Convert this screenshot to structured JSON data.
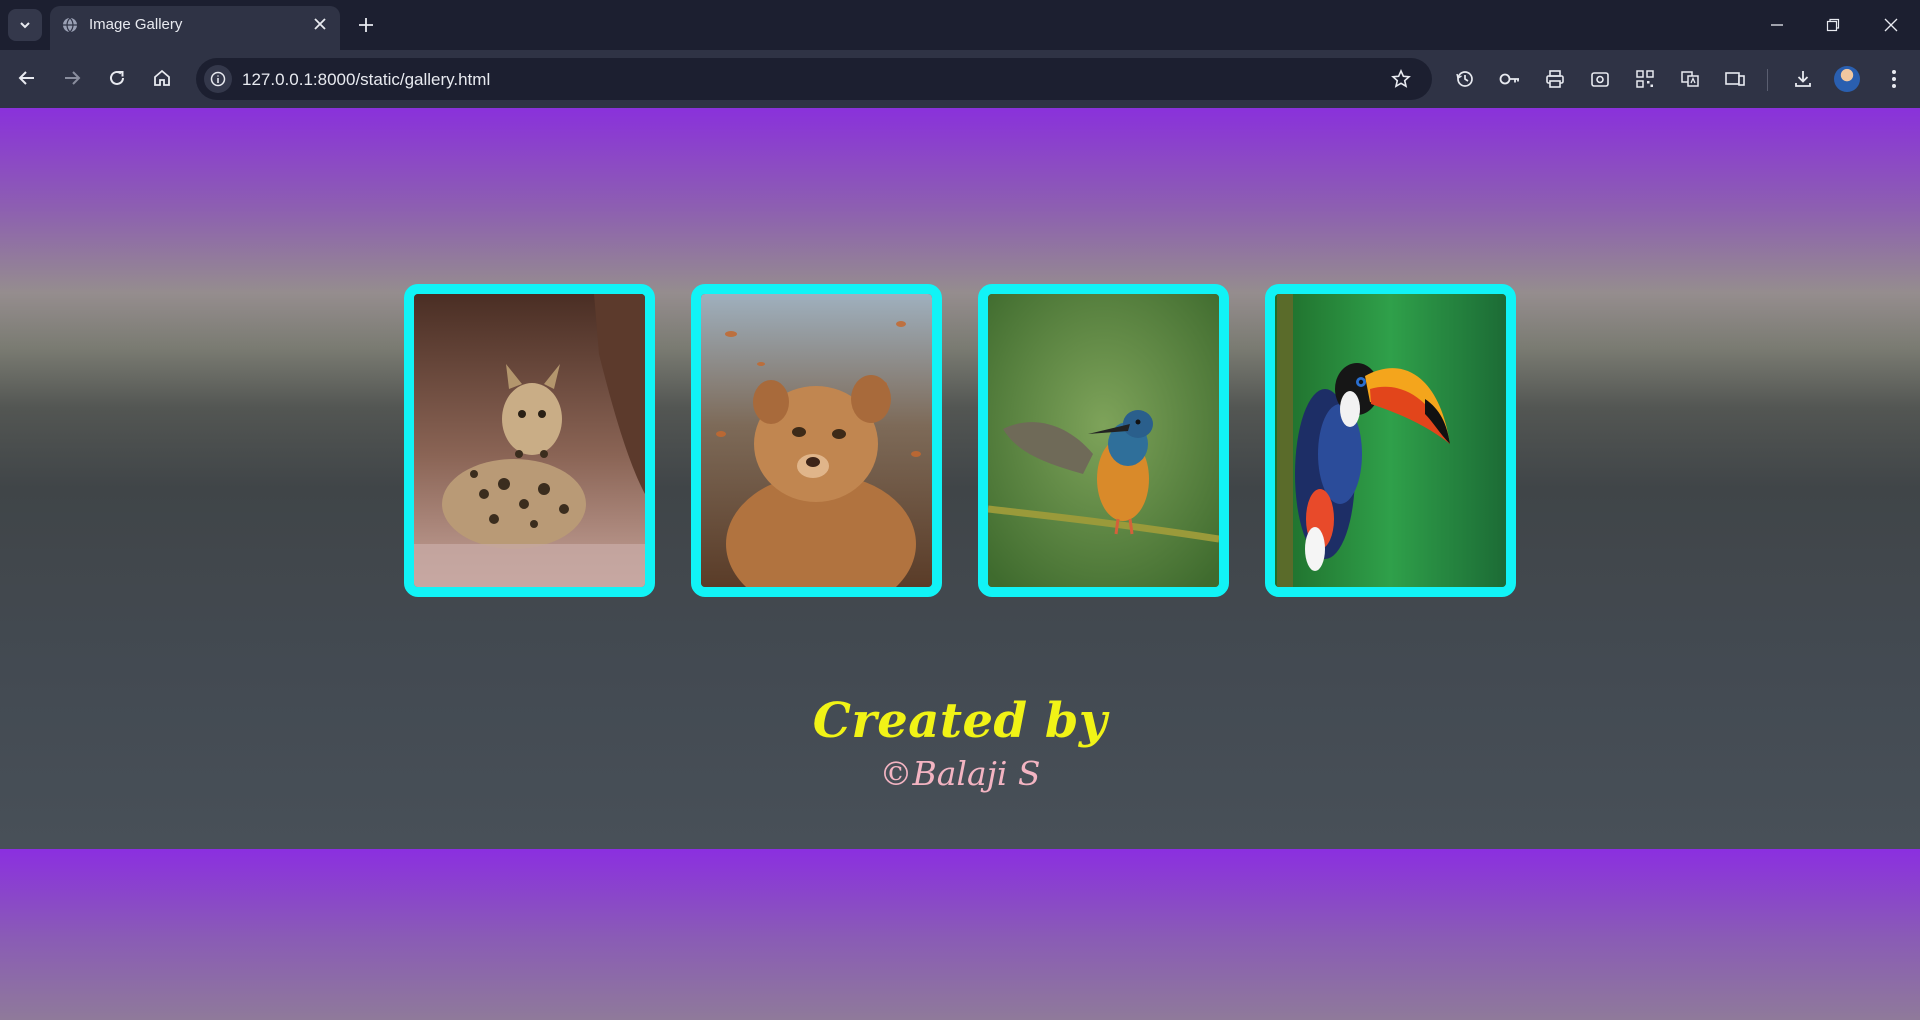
{
  "browser": {
    "tab_title": "Image Gallery",
    "url": "127.0.0.1:8000/static/gallery.html",
    "icons": [
      "tab-list-icon",
      "globe-icon",
      "close-icon",
      "plus-icon",
      "minimize-icon",
      "restore-icon",
      "window-close-icon",
      "back-icon",
      "forward-icon",
      "reload-icon",
      "home-icon",
      "info-icon",
      "star-icon",
      "history-icon",
      "key-icon",
      "print-icon",
      "screenshot-icon",
      "qr-code-icon",
      "translate-icon",
      "devices-icon",
      "download-icon",
      "avatar",
      "more-menu-icon"
    ]
  },
  "gallery": {
    "images": [
      {
        "subject": "ocelot"
      },
      {
        "subject": "lion-cub"
      },
      {
        "subject": "kingfisher"
      },
      {
        "subject": "toucan"
      }
    ],
    "border_color": "#11f3f6"
  },
  "footer": {
    "title": "Created by",
    "author": "©Balaji S",
    "title_color": "#f1f316",
    "author_color": "#f3b4c2"
  },
  "colors": {
    "page_accent": "#8a31db",
    "chrome_dark": "#1c1f30",
    "chrome_toolbar": "#2f3345"
  }
}
